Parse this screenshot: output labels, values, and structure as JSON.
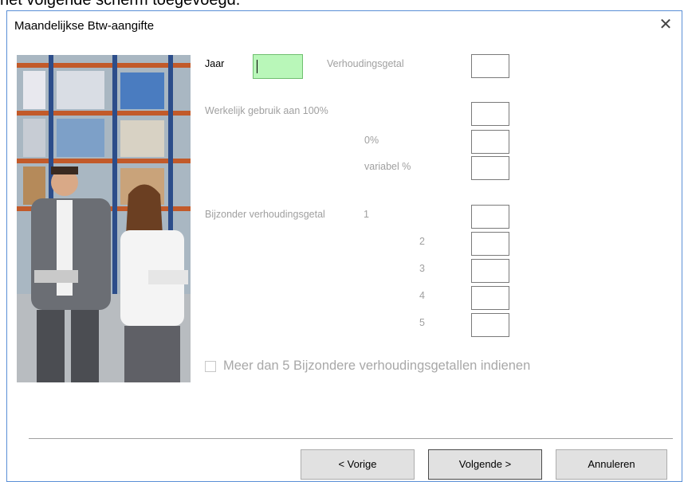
{
  "background_text": "het volgende scherm toegevoegd.",
  "dialog": {
    "title": "Maandelijkse Btw-aangifte",
    "close_icon": "close-icon",
    "photo_icon": "warehouse-photo"
  },
  "form": {
    "jaar_label": "Jaar",
    "jaar_value": "",
    "verhoudingsgetal_label": "Verhoudingsgetal",
    "werkelijk_label": "Werkelijk gebruik aan 100%",
    "pct0_label": "0%",
    "variabel_label": "variabel %",
    "bijzonder_label": "Bijzonder verhoudingsgetal",
    "bijzonder_items": [
      "1",
      "2",
      "3",
      "4",
      "5"
    ],
    "checkbox_label": "Meer dan 5 Bijzondere verhoudingsgetallen indienen",
    "checkbox_checked": false
  },
  "buttons": {
    "prev": "< Vorige",
    "next": "Volgende >",
    "cancel": "Annuleren"
  },
  "colors": {
    "year_field": "#b9f7b9",
    "border_accent": "#5a8fd6"
  }
}
